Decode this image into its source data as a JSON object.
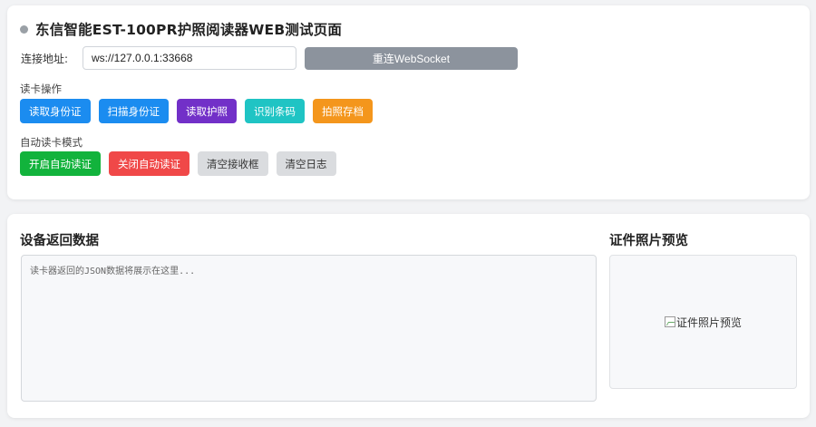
{
  "header": {
    "title": "东信智能EST-100PR护照阅读器WEB测试页面",
    "status_color": "#9aa0a6"
  },
  "connection": {
    "label": "连接地址:",
    "url": "ws://127.0.0.1:33668",
    "reconnect_label": "重连WebSocket"
  },
  "read_section": {
    "label": "读卡操作",
    "buttons": [
      {
        "label": "读取身份证",
        "color": "#1b8cf0"
      },
      {
        "label": "扫描身份证",
        "color": "#1b8cf0"
      },
      {
        "label": "读取护照",
        "color": "#7230c8"
      },
      {
        "label": "识别条码",
        "color": "#1fc4c4"
      },
      {
        "label": "拍照存档",
        "color": "#f4961c"
      }
    ]
  },
  "auto_section": {
    "label": "自动读卡模式",
    "buttons": [
      {
        "label": "开启自动读证",
        "color": "#12b33c"
      },
      {
        "label": "关闭自动读证",
        "color": "#f04848"
      },
      {
        "label": "清空接收框",
        "color": "#dadcdf"
      },
      {
        "label": "清空日志",
        "color": "#dadcdf"
      }
    ]
  },
  "data_panel": {
    "title": "设备返回数据",
    "placeholder": "读卡器返回的JSON数据将展示在这里..."
  },
  "photo_panel": {
    "title": "证件照片预览",
    "alt_text": "证件照片预览",
    "icon": "broken-image-icon"
  }
}
